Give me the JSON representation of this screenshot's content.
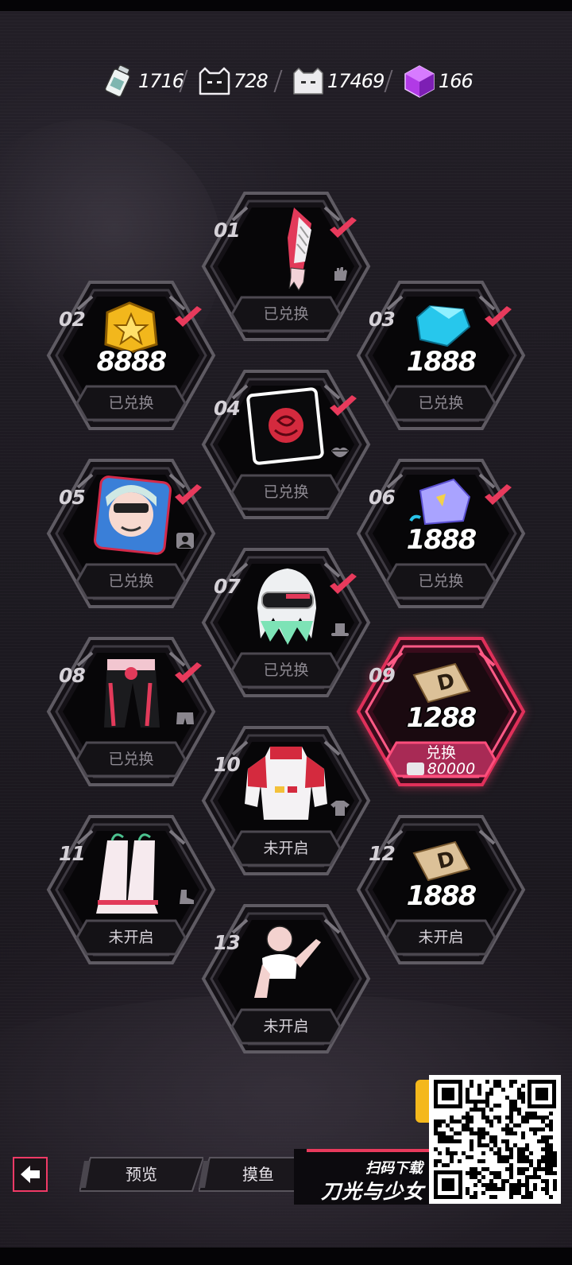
{
  "currencies": [
    {
      "icon": "bottle-icon",
      "value": "1716"
    },
    {
      "icon": "dark-cat-icon",
      "value": "728"
    },
    {
      "icon": "white-cat-icon",
      "value": "17469"
    },
    {
      "icon": "purple-cube-icon",
      "value": "166"
    }
  ],
  "rewards": [
    {
      "num": "01",
      "name": "glove-reward",
      "status": "已兑换",
      "type_icon": "glove-icon"
    },
    {
      "num": "02",
      "name": "gold-coin-reward",
      "amount": "8888",
      "status": "已兑换"
    },
    {
      "num": "03",
      "name": "diamond-reward",
      "amount": "1888",
      "status": "已兑换"
    },
    {
      "num": "04",
      "name": "rose-frame-reward",
      "status": "已兑换",
      "type_icon": "lips-icon"
    },
    {
      "num": "05",
      "name": "avatar-reward",
      "status": "已兑换",
      "type_icon": "portrait-icon"
    },
    {
      "num": "06",
      "name": "crystal-ticket-reward",
      "amount": "1888",
      "status": "已兑换"
    },
    {
      "num": "07",
      "name": "hair-goggles-reward",
      "status": "已兑换",
      "type_icon": "hat-icon"
    },
    {
      "num": "08",
      "name": "pants-reward",
      "status": "已兑换",
      "type_icon": "shorts-icon"
    },
    {
      "num": "09",
      "name": "ticket-reward",
      "amount": "1288",
      "status": "兑换",
      "cost": "80000"
    },
    {
      "num": "10",
      "name": "jacket-reward",
      "status": "未开启",
      "type_icon": "shirt-icon"
    },
    {
      "num": "11",
      "name": "boots-reward",
      "status": "未开启",
      "type_icon": "boot-icon"
    },
    {
      "num": "12",
      "name": "ticket-reward-2",
      "amount": "1888",
      "status": "未开启"
    },
    {
      "num": "13",
      "name": "pose-reward",
      "status": "未开启"
    }
  ],
  "nav": {
    "preview_label": "预览",
    "slack_label": "摸鱼"
  },
  "promo": {
    "scan_text": "扫码下载",
    "game_title": "刀光与少女"
  },
  "colors": {
    "accent": "#f03a66",
    "check": "#e83a5c",
    "frame": "#6d6970",
    "hex_fill": "#070608"
  }
}
